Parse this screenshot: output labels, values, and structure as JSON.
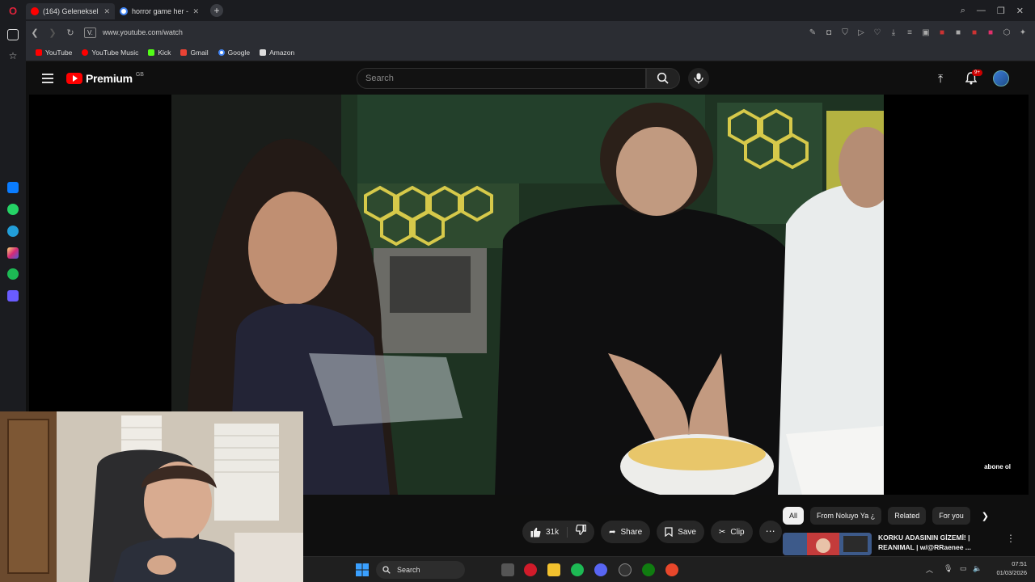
{
  "browser": {
    "tabs": [
      {
        "title": "(164) Geleneksel Sahura D",
        "favicon_color": "#ff0000",
        "active": true
      },
      {
        "title": "horror game her - Google",
        "favicon_color": "#4285f4",
        "active": false
      }
    ],
    "url": "www.youtube.com/watch",
    "vpn_label": "V.",
    "bookmarks": [
      {
        "label": "YouTube",
        "color": "#ff0000"
      },
      {
        "label": "YouTube Music",
        "color": "#ff0000"
      },
      {
        "label": "Kick",
        "color": "#53fc18"
      },
      {
        "label": "Gmail",
        "color": "#ea4335"
      },
      {
        "label": "Google",
        "color": "#4285f4"
      },
      {
        "label": "Amazon",
        "color": "#dddddd"
      }
    ]
  },
  "youtube": {
    "logo_text": "Premium",
    "country_code": "GB",
    "search_placeholder": "Search",
    "notification_count": "9+",
    "subscribe_overlay": "abone ol",
    "actions": {
      "likes": "31k",
      "share": "Share",
      "save": "Save",
      "clip": "Clip"
    },
    "chips": [
      "All",
      "From Noluyo Ya ¿",
      "Related",
      "For you"
    ],
    "recommendation": {
      "title": "KORKU ADASININ GİZEMİ! | REANIMAL | w/@RRaenee ..."
    }
  },
  "taskbar": {
    "search_label": "Search",
    "time": "07:51",
    "date": "01/03/2026"
  }
}
